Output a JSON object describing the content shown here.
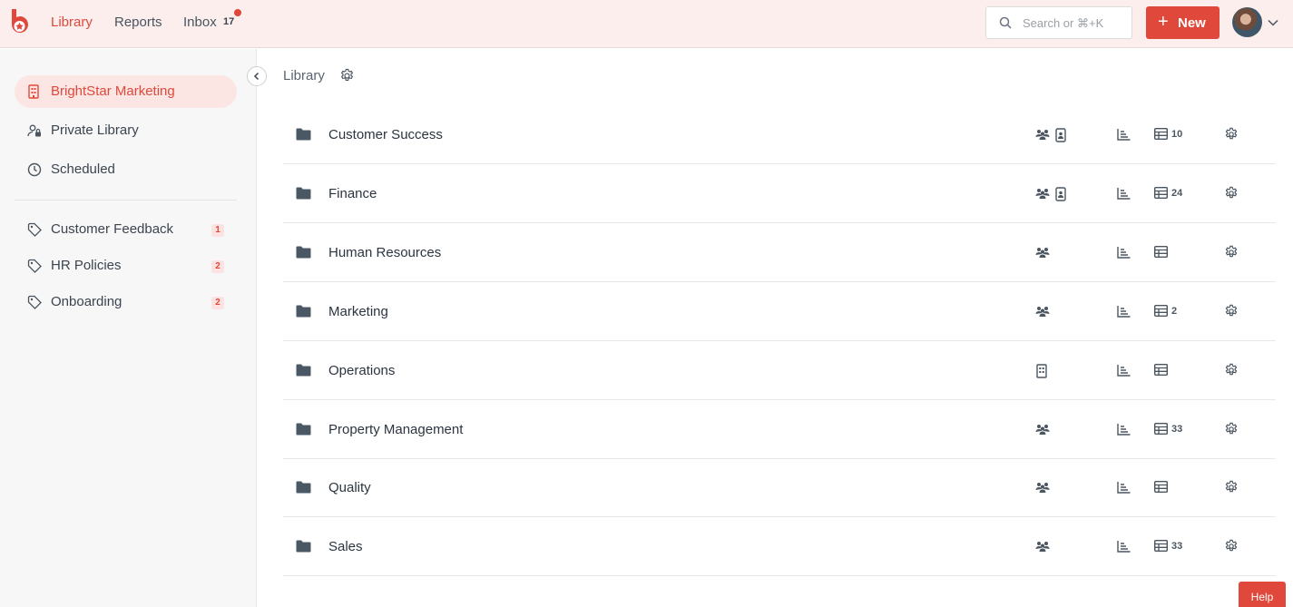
{
  "topbar": {
    "nav": {
      "library": "Library",
      "reports": "Reports",
      "inbox": "Inbox",
      "inbox_count": "17"
    },
    "search_placeholder": "Search or ⌘+K",
    "new_button": "New"
  },
  "sidebar": {
    "workspace": "BrightStar Marketing",
    "items": [
      {
        "label": "Private Library",
        "icon": "private-library-icon"
      },
      {
        "label": "Scheduled",
        "icon": "clock-icon"
      }
    ],
    "tags": [
      {
        "label": "Customer Feedback",
        "count": "1"
      },
      {
        "label": "HR Policies",
        "count": "2"
      },
      {
        "label": "Onboarding",
        "count": "2"
      }
    ]
  },
  "main": {
    "breadcrumb": "Library",
    "folders": [
      {
        "name": "Customer Success",
        "icons": [
          "team-icon",
          "badge-icon"
        ],
        "count": "10"
      },
      {
        "name": "Finance",
        "icons": [
          "team-icon",
          "badge-icon"
        ],
        "count": "24"
      },
      {
        "name": "Human Resources",
        "icons": [
          "team-icon"
        ],
        "count": ""
      },
      {
        "name": "Marketing",
        "icons": [
          "team-icon"
        ],
        "count": "2"
      },
      {
        "name": "Operations",
        "icons": [
          "building-icon"
        ],
        "count": ""
      },
      {
        "name": "Property Management",
        "icons": [
          "team-icon"
        ],
        "count": "33"
      },
      {
        "name": "Quality",
        "icons": [
          "team-icon"
        ],
        "count": ""
      },
      {
        "name": "Sales",
        "icons": [
          "team-icon"
        ],
        "count": "33"
      }
    ]
  },
  "help_label": "Help",
  "colors": {
    "accent": "#e0483b",
    "topbar_bg": "#fbeeed",
    "sidebar_bg": "#f7f7f7"
  }
}
